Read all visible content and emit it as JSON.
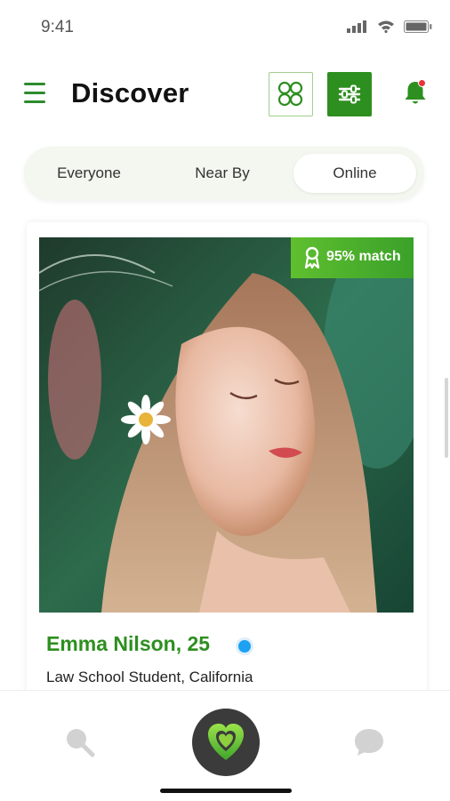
{
  "status_bar": {
    "time": "9:41",
    "icons": [
      "signal-icon",
      "wifi-icon",
      "battery-icon"
    ]
  },
  "header": {
    "title": "Discover"
  },
  "tabs": [
    {
      "label": "Everyone",
      "active": false
    },
    {
      "label": "Near By",
      "active": false
    },
    {
      "label": "Online",
      "active": true
    }
  ],
  "profile": {
    "match_label": "95% match",
    "name": "Emma Nilson, 25",
    "status": "online",
    "subtitle": "Law School Student, California"
  },
  "bottom_nav": {
    "items": [
      "search-icon",
      "heart-icon",
      "chat-icon"
    ],
    "active": "heart-icon"
  },
  "colors": {
    "accent": "#2d8f1f",
    "match_gradient_start": "#5fbf2f",
    "online_dot": "#1da1f2",
    "nav_center": "#3b3b3b"
  }
}
